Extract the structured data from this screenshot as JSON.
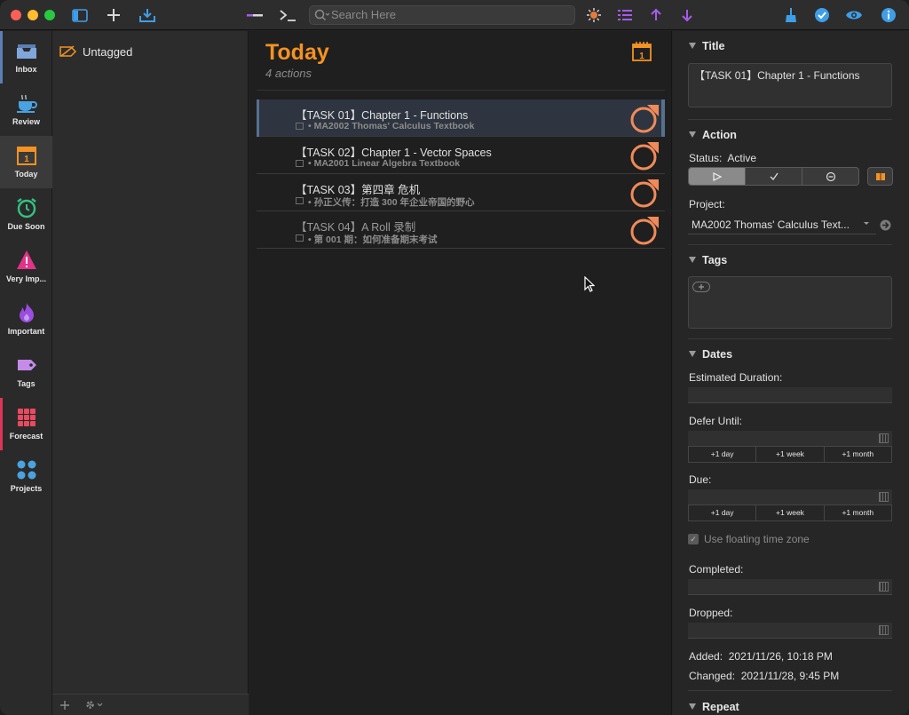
{
  "toolbar": {
    "search_placeholder": "Search Here",
    "colors": {
      "close": "#fe5f57",
      "minimize": "#febc2e",
      "zoom": "#28c840",
      "accent_blue": "#3f9ee8",
      "accent_purple": "#a45de8"
    }
  },
  "sidebar": {
    "items": [
      {
        "label": "Inbox",
        "icon": "inbox-icon"
      },
      {
        "label": "Review",
        "icon": "review-cup-icon"
      },
      {
        "label": "Today",
        "icon": "today-calendar-icon"
      },
      {
        "label": "Due Soon",
        "icon": "due-soon-alarm-icon"
      },
      {
        "label": "Very Imp...",
        "icon": "warning-triangle-icon"
      },
      {
        "label": "Important",
        "icon": "flame-icon"
      },
      {
        "label": "Tags",
        "icon": "tag-icon"
      },
      {
        "label": "Forecast",
        "icon": "forecast-grid-icon"
      },
      {
        "label": "Projects",
        "icon": "projects-dots-icon"
      }
    ]
  },
  "tags_pane": {
    "untagged_label": "Untagged",
    "calendar_day": "1"
  },
  "main": {
    "title": "Today",
    "subtitle": "4 actions",
    "tasks": [
      {
        "title": "【TASK 01】Chapter 1 - Functions",
        "project": "• MA2002 Thomas' Calculus Textbook"
      },
      {
        "title": "【TASK 02】Chapter 1 - Vector Spaces",
        "project": "• MA2001 Linear Algebra Textbook"
      },
      {
        "title": "【TASK 03】第四章 危机",
        "project": "• 孙正义传：打造 300 年企业帝国的野心"
      },
      {
        "title": "【TASK 04】A Roll 录制",
        "project": "• 第 001 期：如何准备期末考试"
      }
    ]
  },
  "inspector": {
    "title_section": "Title",
    "title_value": "【TASK 01】Chapter 1 - Functions",
    "action_section": "Action",
    "status_label": "Status:",
    "status_value": "Active",
    "project_label": "Project:",
    "project_value": "MA2002 Thomas' Calculus Text...",
    "tags_section": "Tags",
    "dates_section": "Dates",
    "estimated_label": "Estimated Duration:",
    "defer_label": "Defer Until:",
    "due_label": "Due:",
    "jump_day": "+1 day",
    "jump_week": "+1 week",
    "jump_month": "+1 month",
    "floating_label": "Use floating time zone",
    "completed_label": "Completed:",
    "dropped_label": "Dropped:",
    "added_label": "Added:",
    "added_value": "2021/11/26, 10:18 PM",
    "changed_label": "Changed:",
    "changed_value": "2021/11/28, 9:45 PM",
    "repeat_section": "Repeat"
  }
}
